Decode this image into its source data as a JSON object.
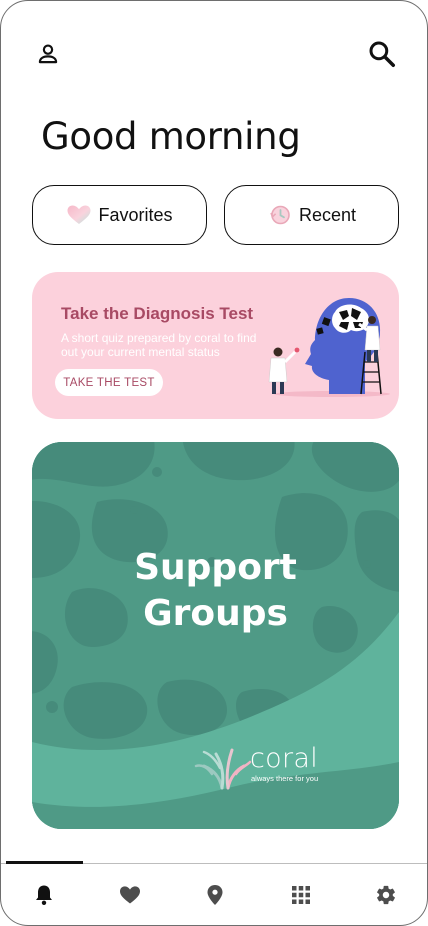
{
  "header": {
    "profile_icon": "person-outline-icon",
    "search_icon": "search-icon"
  },
  "greeting": "Good morning",
  "quick_filters": [
    {
      "label": "Favorites",
      "icon": "heart-icon"
    },
    {
      "label": "Recent",
      "icon": "history-icon"
    }
  ],
  "diagnosis_card": {
    "title": "Take the Diagnosis Test",
    "subtitle": "A short quiz prepared by coral to find out your current mental status",
    "button_label": "TAKE THE TEST",
    "illustration": "doctors-head-puzzle-illustration",
    "colors": {
      "background": "#fcd1dc",
      "accent": "#a84a64"
    }
  },
  "support_card": {
    "title_line1": "Support",
    "title_line2": "Groups",
    "brand_name": "coral",
    "brand_tagline": "always there for you",
    "colors": {
      "background": "#4f9a86",
      "blobs": "#45877a",
      "wave": "#5fb39c"
    }
  },
  "bottom_nav": {
    "items": [
      {
        "name": "notifications",
        "icon": "bell-icon",
        "active": true
      },
      {
        "name": "favorites",
        "icon": "heart-icon",
        "active": false
      },
      {
        "name": "location",
        "icon": "location-pin-icon",
        "active": false
      },
      {
        "name": "apps",
        "icon": "grid-icon",
        "active": false
      },
      {
        "name": "settings",
        "icon": "gear-icon",
        "active": false
      }
    ]
  }
}
